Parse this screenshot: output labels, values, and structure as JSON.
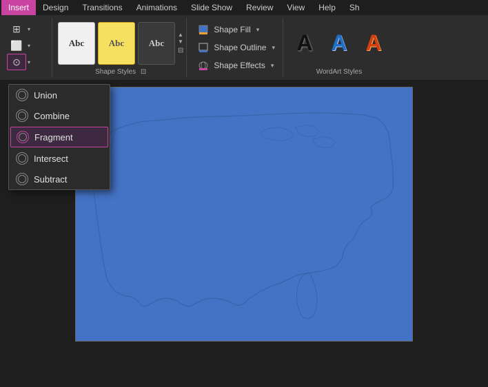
{
  "tabs": [
    {
      "label": "Insert",
      "active": true
    },
    {
      "label": "Design",
      "active": false
    },
    {
      "label": "Transitions",
      "active": false
    },
    {
      "label": "Animations",
      "active": false
    },
    {
      "label": "Slide Show",
      "active": false
    },
    {
      "label": "Review",
      "active": false
    },
    {
      "label": "View",
      "active": false
    },
    {
      "label": "Help",
      "active": false
    },
    {
      "label": "Sh",
      "active": false
    }
  ],
  "ribbon": {
    "shape_styles_label": "Shape Styles",
    "wordart_label": "WordArt Styles",
    "shape_fill": "Shape Fill",
    "shape_outline": "Shape Outline",
    "shape_effects": "Shape Effects",
    "shape_thumbs": [
      "Abc",
      "Abc",
      "Abc"
    ],
    "wordart_letters": [
      "A",
      "A",
      "A"
    ]
  },
  "dropdown": {
    "items": [
      {
        "label": "Union",
        "highlighted": false
      },
      {
        "label": "Combine",
        "highlighted": false
      },
      {
        "label": "Fragment",
        "highlighted": true
      },
      {
        "label": "Intersect",
        "highlighted": false
      },
      {
        "label": "Subtract",
        "highlighted": false
      }
    ]
  },
  "group_labels": [
    {
      "label": "Shape Styles",
      "expandable": true
    },
    {
      "label": "WordArt Styles",
      "expandable": false
    }
  ]
}
